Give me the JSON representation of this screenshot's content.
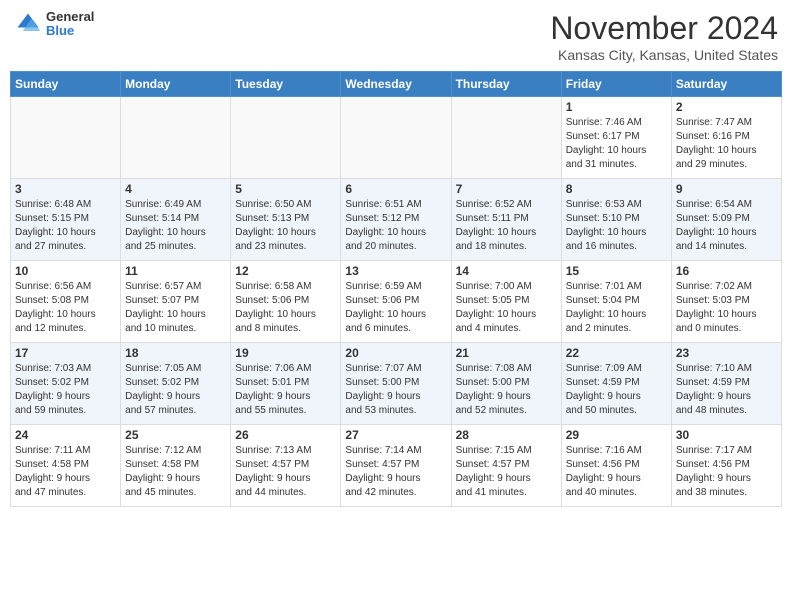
{
  "header": {
    "logo": {
      "general": "General",
      "blue": "Blue"
    },
    "title": "November 2024",
    "location": "Kansas City, Kansas, United States"
  },
  "calendar": {
    "days_of_week": [
      "Sunday",
      "Monday",
      "Tuesday",
      "Wednesday",
      "Thursday",
      "Friday",
      "Saturday"
    ],
    "weeks": [
      [
        {
          "day": "",
          "info": ""
        },
        {
          "day": "",
          "info": ""
        },
        {
          "day": "",
          "info": ""
        },
        {
          "day": "",
          "info": ""
        },
        {
          "day": "",
          "info": ""
        },
        {
          "day": "1",
          "info": "Sunrise: 7:46 AM\nSunset: 6:17 PM\nDaylight: 10 hours\nand 31 minutes."
        },
        {
          "day": "2",
          "info": "Sunrise: 7:47 AM\nSunset: 6:16 PM\nDaylight: 10 hours\nand 29 minutes."
        }
      ],
      [
        {
          "day": "3",
          "info": "Sunrise: 6:48 AM\nSunset: 5:15 PM\nDaylight: 10 hours\nand 27 minutes."
        },
        {
          "day": "4",
          "info": "Sunrise: 6:49 AM\nSunset: 5:14 PM\nDaylight: 10 hours\nand 25 minutes."
        },
        {
          "day": "5",
          "info": "Sunrise: 6:50 AM\nSunset: 5:13 PM\nDaylight: 10 hours\nand 23 minutes."
        },
        {
          "day": "6",
          "info": "Sunrise: 6:51 AM\nSunset: 5:12 PM\nDaylight: 10 hours\nand 20 minutes."
        },
        {
          "day": "7",
          "info": "Sunrise: 6:52 AM\nSunset: 5:11 PM\nDaylight: 10 hours\nand 18 minutes."
        },
        {
          "day": "8",
          "info": "Sunrise: 6:53 AM\nSunset: 5:10 PM\nDaylight: 10 hours\nand 16 minutes."
        },
        {
          "day": "9",
          "info": "Sunrise: 6:54 AM\nSunset: 5:09 PM\nDaylight: 10 hours\nand 14 minutes."
        }
      ],
      [
        {
          "day": "10",
          "info": "Sunrise: 6:56 AM\nSunset: 5:08 PM\nDaylight: 10 hours\nand 12 minutes."
        },
        {
          "day": "11",
          "info": "Sunrise: 6:57 AM\nSunset: 5:07 PM\nDaylight: 10 hours\nand 10 minutes."
        },
        {
          "day": "12",
          "info": "Sunrise: 6:58 AM\nSunset: 5:06 PM\nDaylight: 10 hours\nand 8 minutes."
        },
        {
          "day": "13",
          "info": "Sunrise: 6:59 AM\nSunset: 5:06 PM\nDaylight: 10 hours\nand 6 minutes."
        },
        {
          "day": "14",
          "info": "Sunrise: 7:00 AM\nSunset: 5:05 PM\nDaylight: 10 hours\nand 4 minutes."
        },
        {
          "day": "15",
          "info": "Sunrise: 7:01 AM\nSunset: 5:04 PM\nDaylight: 10 hours\nand 2 minutes."
        },
        {
          "day": "16",
          "info": "Sunrise: 7:02 AM\nSunset: 5:03 PM\nDaylight: 10 hours\nand 0 minutes."
        }
      ],
      [
        {
          "day": "17",
          "info": "Sunrise: 7:03 AM\nSunset: 5:02 PM\nDaylight: 9 hours\nand 59 minutes."
        },
        {
          "day": "18",
          "info": "Sunrise: 7:05 AM\nSunset: 5:02 PM\nDaylight: 9 hours\nand 57 minutes."
        },
        {
          "day": "19",
          "info": "Sunrise: 7:06 AM\nSunset: 5:01 PM\nDaylight: 9 hours\nand 55 minutes."
        },
        {
          "day": "20",
          "info": "Sunrise: 7:07 AM\nSunset: 5:00 PM\nDaylight: 9 hours\nand 53 minutes."
        },
        {
          "day": "21",
          "info": "Sunrise: 7:08 AM\nSunset: 5:00 PM\nDaylight: 9 hours\nand 52 minutes."
        },
        {
          "day": "22",
          "info": "Sunrise: 7:09 AM\nSunset: 4:59 PM\nDaylight: 9 hours\nand 50 minutes."
        },
        {
          "day": "23",
          "info": "Sunrise: 7:10 AM\nSunset: 4:59 PM\nDaylight: 9 hours\nand 48 minutes."
        }
      ],
      [
        {
          "day": "24",
          "info": "Sunrise: 7:11 AM\nSunset: 4:58 PM\nDaylight: 9 hours\nand 47 minutes."
        },
        {
          "day": "25",
          "info": "Sunrise: 7:12 AM\nSunset: 4:58 PM\nDaylight: 9 hours\nand 45 minutes."
        },
        {
          "day": "26",
          "info": "Sunrise: 7:13 AM\nSunset: 4:57 PM\nDaylight: 9 hours\nand 44 minutes."
        },
        {
          "day": "27",
          "info": "Sunrise: 7:14 AM\nSunset: 4:57 PM\nDaylight: 9 hours\nand 42 minutes."
        },
        {
          "day": "28",
          "info": "Sunrise: 7:15 AM\nSunset: 4:57 PM\nDaylight: 9 hours\nand 41 minutes."
        },
        {
          "day": "29",
          "info": "Sunrise: 7:16 AM\nSunset: 4:56 PM\nDaylight: 9 hours\nand 40 minutes."
        },
        {
          "day": "30",
          "info": "Sunrise: 7:17 AM\nSunset: 4:56 PM\nDaylight: 9 hours\nand 38 minutes."
        }
      ]
    ]
  }
}
